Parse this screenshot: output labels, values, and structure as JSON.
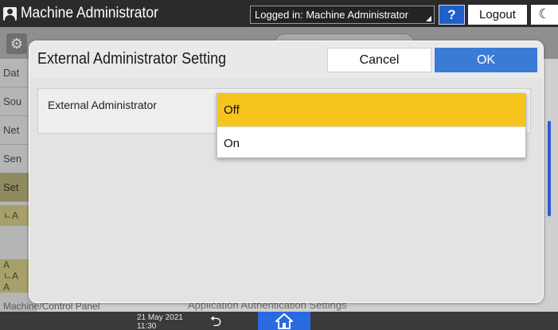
{
  "topbar": {
    "user_icon": "user-icon",
    "title": "Machine Administrator",
    "login_status": "Logged in: Machine Administrator",
    "help_label": "?",
    "logout_label": "Logout",
    "energy_saver_icon": "moon-icon",
    "help_color": "#1e5fc9"
  },
  "background_screen": {
    "settings_icon": "gear-icon",
    "sidebar": {
      "items": [
        {
          "label": "Dat"
        },
        {
          "label": "Sou"
        },
        {
          "label": "Net"
        },
        {
          "label": "Sen"
        },
        {
          "label": "Set"
        }
      ],
      "subitems": [
        {
          "label": "ㄴA"
        },
        {
          "label": "A"
        },
        {
          "label": "ㄴA"
        },
        {
          "label": "A"
        }
      ]
    },
    "bottom_left": "Machine/Control Panel",
    "bottom_center": "Application Authentication Settings"
  },
  "dialog": {
    "title": "External Administrator Setting",
    "cancel_label": "Cancel",
    "ok_label": "OK",
    "ok_color": "#3a7bd5",
    "setting": {
      "label": "External Administrator",
      "options": [
        {
          "label": "Off",
          "selected": true
        },
        {
          "label": "On",
          "selected": false
        }
      ],
      "selected_color": "#f5c51d"
    }
  },
  "bottombar": {
    "date": "21 May 2021",
    "time": "11:30",
    "back_icon": "back-arrow-icon",
    "home_icon": "home-icon",
    "home_color": "#2a6ae0"
  }
}
